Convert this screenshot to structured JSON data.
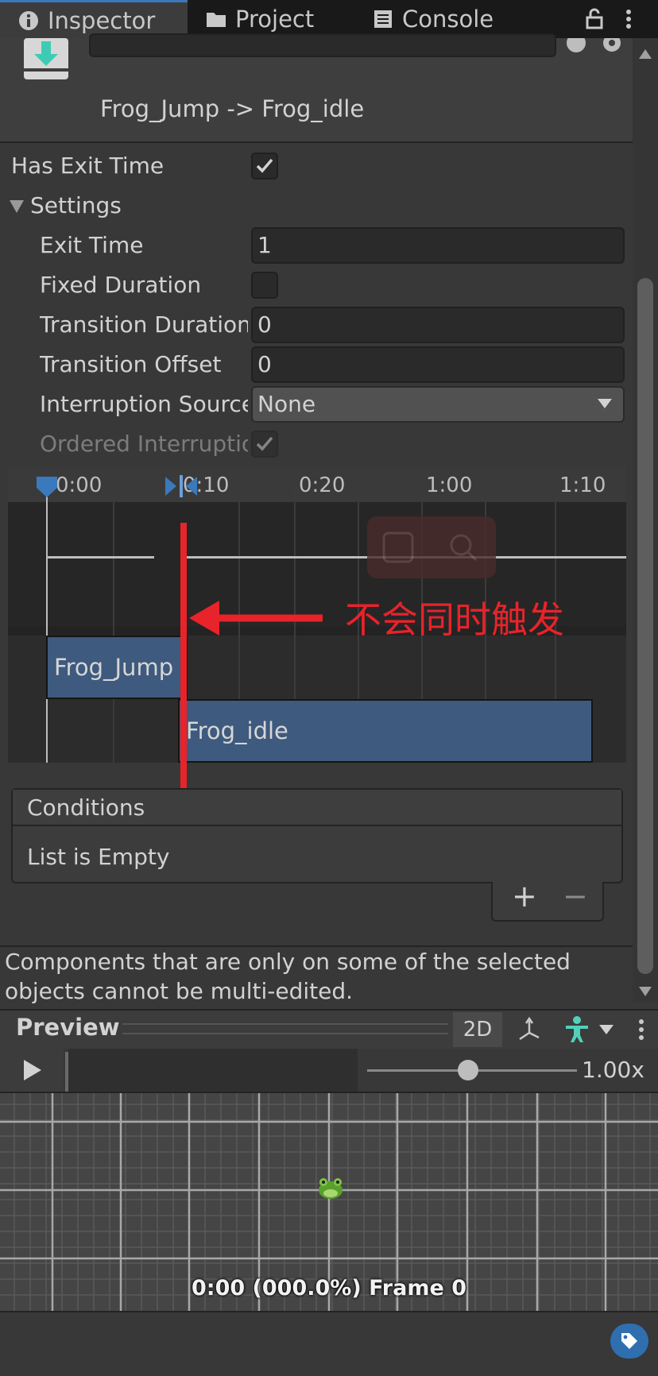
{
  "tabs": [
    {
      "label": "Inspector",
      "icon": "info-icon",
      "active": true
    },
    {
      "label": "Project",
      "icon": "folder-icon",
      "active": false
    },
    {
      "label": "Console",
      "icon": "console-icon",
      "active": false
    }
  ],
  "header": {
    "transition_title": "Frog_Jump -> Frog_idle"
  },
  "props": {
    "has_exit_time_label": "Has Exit Time",
    "settings_label": "Settings",
    "exit_time_label": "Exit Time",
    "exit_time_value": "1",
    "fixed_duration_label": "Fixed Duration",
    "transition_duration_label": "Transition Duration",
    "transition_duration_value": "0",
    "transition_offset_label": "Transition Offset",
    "transition_offset_value": "0",
    "interruption_source_label": "Interruption Source",
    "interruption_source_value": "None",
    "ordered_interruption_label": "Ordered Interruption"
  },
  "timeline": {
    "ticks": [
      "0:00",
      "0:10",
      "0:20",
      "1:00",
      "1:10"
    ],
    "clip_from": "Frog_Jump",
    "clip_to": "Frog_idle"
  },
  "annotation": {
    "text": "不会同时触发",
    "color": "#e8232a"
  },
  "conditions": {
    "title": "Conditions",
    "empty_text": "List is Empty",
    "add": "+",
    "remove": "−"
  },
  "message": "Components that are only on some of the selected objects cannot be multi-edited.",
  "preview": {
    "title": "Preview",
    "mode_2d": "2D",
    "speed": "1.00x",
    "status": "0:00 (000.0%) Frame 0"
  },
  "colors": {
    "accent": "#3a79bb",
    "clip": "#3e5a7e",
    "avatar": "#52d0b9"
  }
}
